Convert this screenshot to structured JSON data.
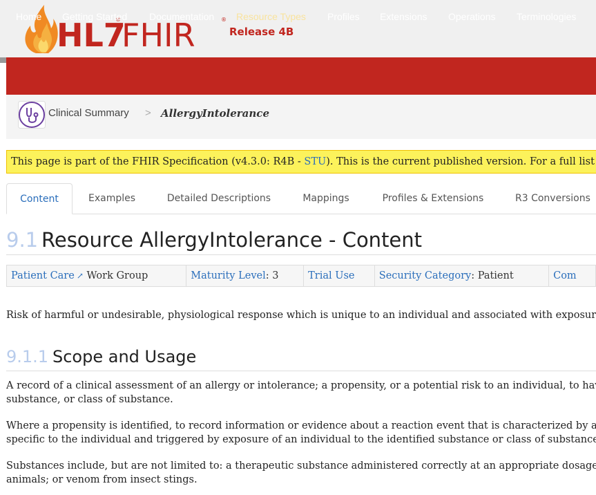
{
  "header": {
    "logo_text": "HL7 FHIR",
    "release": "Release 4B"
  },
  "nav": {
    "items": [
      {
        "label": "Home"
      },
      {
        "label": "Getting Started"
      },
      {
        "label": "Documentation"
      },
      {
        "label": "Resource Types"
      },
      {
        "label": "Profiles"
      },
      {
        "label": "Extensions"
      },
      {
        "label": "Operations"
      },
      {
        "label": "Terminologies"
      }
    ],
    "active": "Resource Types"
  },
  "breadcrumb": {
    "parent": "Clinical Summary",
    "separator": ">",
    "current": "AllergyIntolerance"
  },
  "notice": {
    "prefix": "This page is part of the FHIR Specification (v4.3.0: R4B - ",
    "link": "STU",
    "suffix": "). This is the current published version. For a full list of"
  },
  "tabs": [
    {
      "label": "Content"
    },
    {
      "label": "Examples"
    },
    {
      "label": "Detailed Descriptions"
    },
    {
      "label": "Mappings"
    },
    {
      "label": "Profiles & Extensions"
    },
    {
      "label": "R3 Conversions"
    }
  ],
  "heading": {
    "number": "9.1",
    "title": "Resource AllergyIntolerance - Content"
  },
  "info": {
    "workgroup_link": "Patient Care",
    "workgroup_suffix": " Work Group",
    "maturity_label": "Maturity Level",
    "maturity_value": ": 3",
    "trial_use": "Trial Use",
    "security_label": "Security Category",
    "security_value": ": Patient",
    "compartments": "Com"
  },
  "description": "Risk of harmful or undesirable, physiological response which is unique to an individual and associated with exposure",
  "subheading": {
    "number": "9.1.1",
    "title": "Scope and Usage"
  },
  "paragraphs": [
    [
      "A record of a clinical assessment of an allergy or intolerance; a propensity, or a potential risk to an individual, to hav",
      "substance, or class of substance."
    ],
    [
      "Where a propensity is identified, to record information or evidence about a reaction event that is characterized by an",
      "specific to the individual and triggered by exposure of an individual to the identified substance or class of substance."
    ],
    [
      "Substances include, but are not limited to: a therapeutic substance administered correctly at an appropriate dosage",
      "animals; or venom from insect stings."
    ]
  ],
  "colors": {
    "brand_red": "#c1261f",
    "link_blue": "#2a6ebb",
    "active_nav": "#f9e39e",
    "notice_yellow": "#fcf25b"
  }
}
